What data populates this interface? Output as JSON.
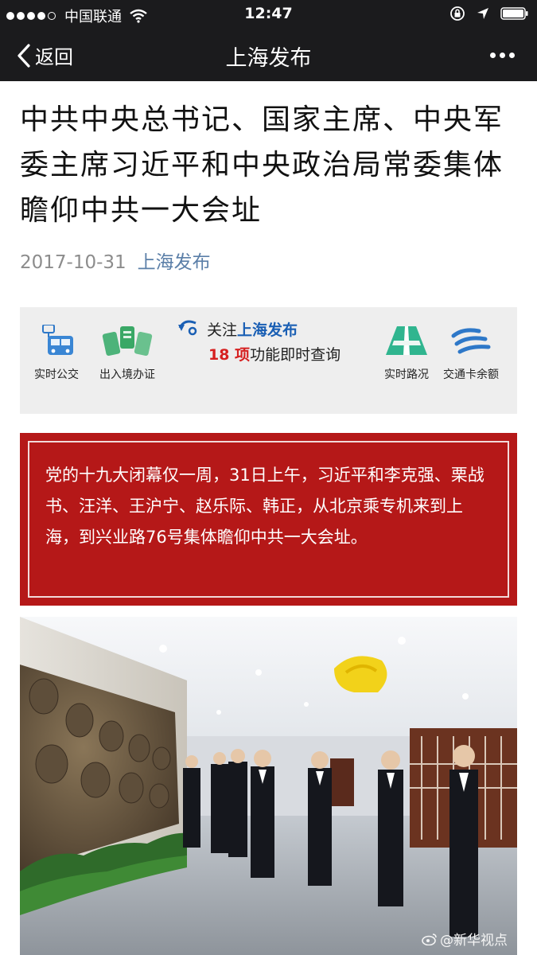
{
  "status_bar": {
    "carrier": "中国联通",
    "time": "12:47",
    "signal_icon": "signal-dots-icon",
    "wifi_icon": "wifi-icon",
    "rotation_lock_icon": "rotation-lock-icon",
    "location_icon": "location-arrow-icon",
    "battery_icon": "battery-icon"
  },
  "nav": {
    "back_label": "返回",
    "title": "上海发布",
    "more_icon": "more-dots-icon"
  },
  "article": {
    "title": "中共中央总书记、国家主席、中央军委主席习近平和中央政治局常委集体瞻仰中共一大会址",
    "date": "2017-10-31",
    "source": "上海发布"
  },
  "banner": {
    "items_left": [
      {
        "label": "实时公交",
        "icon": "bus-icon"
      },
      {
        "label": "出入境办证",
        "icon": "passport-icon"
      }
    ],
    "follow_prefix": "关注",
    "follow_account": "上海发布",
    "follow_count": "18 项",
    "follow_suffix": "功能即时查询",
    "items_right": [
      {
        "label": "实时路况",
        "icon": "road-icon"
      },
      {
        "label": "交通卡余额",
        "icon": "transit-card-icon"
      }
    ]
  },
  "quote": {
    "text": "党的十九大闭幕仅一周，31日上午，习近平和李克强、栗战书、汪洋、王沪宁、赵乐际、韩正，从北京乘专机来到上海，到兴业路76号集体瞻仰中共一大会址。"
  },
  "photo": {
    "watermark": "@新华视点",
    "colors": {
      "ceiling": "#eef1f4",
      "floor": "#b9bec5",
      "relief": "#6b5a45",
      "emblem": "#f2d21a",
      "suit": "#15171d"
    }
  },
  "colors": {
    "bar_bg": "#1b1b1d",
    "quote_bg": "#b51818",
    "source_link": "#5b7fa8",
    "banner_bg": "#eeeeee"
  }
}
